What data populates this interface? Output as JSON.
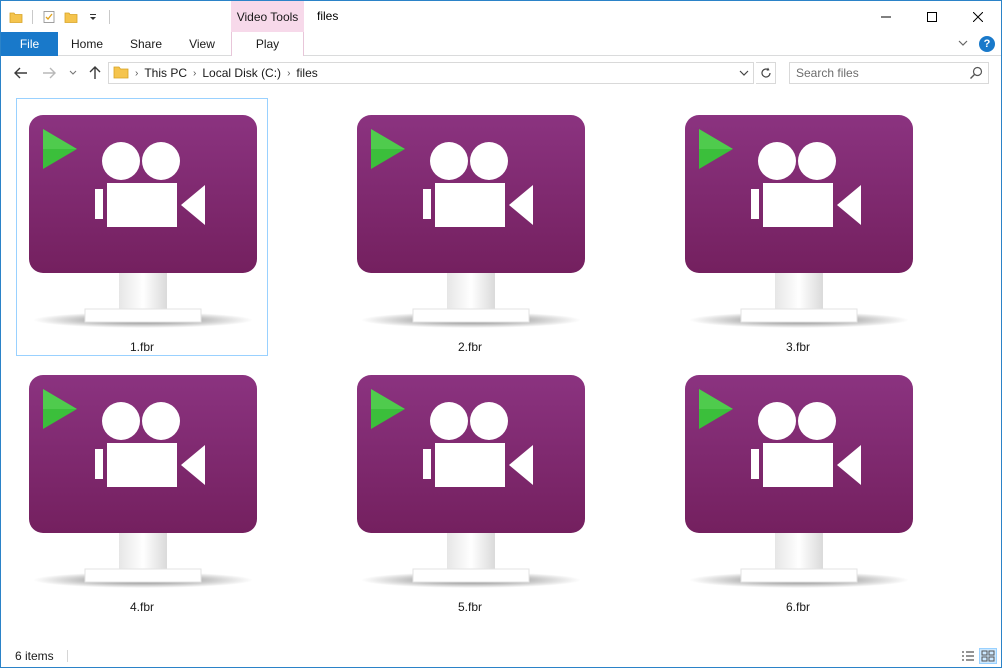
{
  "window": {
    "title": "files",
    "context_tab_group": "Video Tools"
  },
  "quick_access": {
    "icons": [
      "folder-icon",
      "properties-icon",
      "new-folder-icon",
      "customize-dropdown-icon"
    ]
  },
  "caption": {
    "minimize": "minimize-icon",
    "maximize": "maximize-icon",
    "close": "close-icon"
  },
  "ribbon": {
    "tabs": [
      {
        "label": "File"
      },
      {
        "label": "Home"
      },
      {
        "label": "Share"
      },
      {
        "label": "View"
      },
      {
        "label": "Play"
      }
    ],
    "help_label": "?"
  },
  "address_bar": {
    "crumbs": [
      {
        "label": "This PC"
      },
      {
        "label": "Local Disk (C:)"
      },
      {
        "label": "files"
      }
    ]
  },
  "search": {
    "placeholder": "Search files"
  },
  "files": [
    {
      "name": "1.fbr",
      "selected": true
    },
    {
      "name": "2.fbr",
      "selected": false
    },
    {
      "name": "3.fbr",
      "selected": false
    },
    {
      "name": "4.fbr",
      "selected": false
    },
    {
      "name": "5.fbr",
      "selected": false
    },
    {
      "name": "6.fbr",
      "selected": false
    }
  ],
  "status": {
    "item_count": "6 items"
  },
  "colors": {
    "accent": "#1979ca",
    "context_tab": "#f7d9ea",
    "icon_screen": "#7d2a6f",
    "play_triangle": "#3bbf3b",
    "selection_border": "#99d1ff"
  }
}
